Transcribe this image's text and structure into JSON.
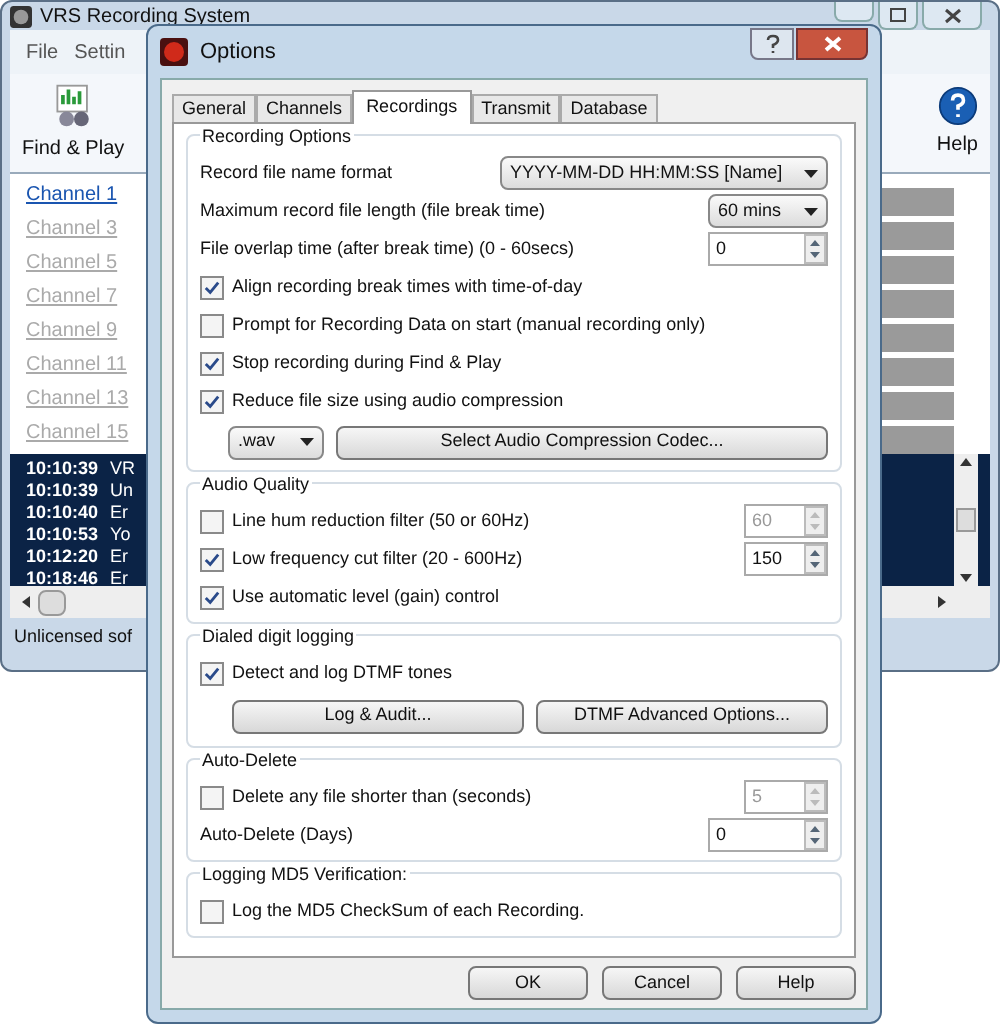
{
  "main_window": {
    "title": "VRS Recording System",
    "menu": [
      {
        "label": "File"
      },
      {
        "label": "Settin"
      }
    ],
    "toolbar": [
      {
        "label": "Find & Play",
        "kind": "find"
      },
      {
        "label": "Help",
        "kind": "help"
      }
    ],
    "channels": [
      {
        "label": "Channel 1",
        "active": true
      },
      {
        "label": "Channel 3",
        "active": false
      },
      {
        "label": "Channel 5",
        "active": false
      },
      {
        "label": "Channel 7",
        "active": false
      },
      {
        "label": "Channel 9",
        "active": false
      },
      {
        "label": "Channel 11",
        "active": false
      },
      {
        "label": "Channel 13",
        "active": false
      },
      {
        "label": "Channel 15",
        "active": false
      }
    ],
    "log": [
      {
        "time": "10:10:39",
        "message": "VR"
      },
      {
        "time": "10:10:39",
        "message": "Un"
      },
      {
        "time": "10:10:40",
        "message": "Er"
      },
      {
        "time": "10:10:53",
        "message": "Yo"
      },
      {
        "time": "10:12:20",
        "message": "Er"
      },
      {
        "time": "10:18:46",
        "message": "Er"
      }
    ],
    "status": "Unlicensed sof"
  },
  "dialog": {
    "title": "Options",
    "tabs": [
      {
        "label": "General",
        "selected": false
      },
      {
        "label": "Channels",
        "selected": false
      },
      {
        "label": "Recordings",
        "selected": true
      },
      {
        "label": "Transmit",
        "selected": false
      },
      {
        "label": "Database",
        "selected": false
      }
    ],
    "groups": [
      {
        "title": "Recording Options",
        "rows": [
          {
            "kind": "wide_select",
            "label": "Record file name format",
            "value": "YYYY-MM-DD HH:MM:SS [Name]"
          },
          {
            "kind": "select",
            "label": "Maximum record file length (file break time)",
            "value": "60 mins"
          },
          {
            "kind": "spin",
            "label": "File overlap time (after break time) (0 - 60secs)",
            "value": "0",
            "disabled": false
          },
          {
            "kind": "check",
            "label": "Align recording break times with time-of-day",
            "checked": true
          },
          {
            "kind": "check",
            "label": "Prompt for Recording Data on start (manual recording only)",
            "checked": false
          },
          {
            "kind": "check",
            "label": "Stop recording during Find & Play",
            "checked": true
          },
          {
            "kind": "check",
            "label": "Reduce file size using audio compression",
            "checked": true
          },
          {
            "kind": "codec",
            "format": ".wav",
            "button": "Select Audio Compression Codec..."
          }
        ]
      },
      {
        "title": "Audio Quality",
        "rows": [
          {
            "kind": "check_spin",
            "label": "Line hum reduction filter (50 or 60Hz)",
            "checked": false,
            "value": "60",
            "disabled": true
          },
          {
            "kind": "check_spin",
            "label": "Low frequency cut filter (20 - 600Hz)",
            "checked": true,
            "value": "150",
            "disabled": false
          },
          {
            "kind": "check",
            "label": "Use automatic level (gain) control",
            "checked": true
          }
        ]
      },
      {
        "title": "Dialed digit logging",
        "rows": [
          {
            "kind": "check",
            "label": "Detect and log DTMF tones",
            "checked": true
          },
          {
            "kind": "buttons",
            "buttons": [
              "Log & Audit...",
              "DTMF Advanced Options..."
            ]
          }
        ]
      },
      {
        "title": "Auto-Delete",
        "rows": [
          {
            "kind": "check_spin",
            "label": "Delete any file shorter than (seconds)",
            "checked": false,
            "value": "5",
            "disabled": true
          },
          {
            "kind": "spin",
            "label": "Auto-Delete (Days)",
            "value": "0",
            "disabled": false
          }
        ]
      },
      {
        "title": "Logging MD5 Verification:",
        "rows": [
          {
            "kind": "check",
            "label": "Log the MD5 CheckSum of each Recording.",
            "checked": false
          }
        ]
      }
    ],
    "buttons": [
      "OK",
      "Cancel",
      "Help"
    ]
  }
}
